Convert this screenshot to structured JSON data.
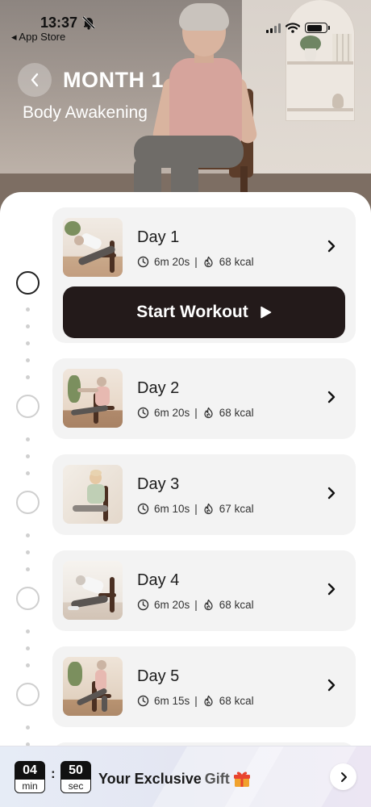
{
  "status_bar": {
    "time": "13:37",
    "back_app": "◂ App Store"
  },
  "header": {
    "title": "MONTH 1",
    "subtitle": "Body Awakening"
  },
  "start_button": {
    "label": "Start Workout"
  },
  "days": [
    {
      "title": "Day 1",
      "duration": "6m 20s",
      "separator": "|",
      "calories": "68 kcal"
    },
    {
      "title": "Day 2",
      "duration": "6m 20s",
      "separator": "|",
      "calories": "68 kcal"
    },
    {
      "title": "Day 3",
      "duration": "6m 10s",
      "separator": "|",
      "calories": "67 kcal"
    },
    {
      "title": "Day 4",
      "duration": "6m 20s",
      "separator": "|",
      "calories": "68 kcal"
    },
    {
      "title": "Day 5",
      "duration": "6m 15s",
      "separator": "|",
      "calories": "68 kcal"
    }
  ],
  "promo": {
    "minutes": "04",
    "minutes_unit": "min",
    "colon": ":",
    "seconds": "50",
    "seconds_unit": "sec",
    "text_main": "Your Exclusive",
    "text_soft": "Gift"
  },
  "icons": {
    "back": "chevron-left-icon",
    "chevron": "chevron-right-icon",
    "clock": "clock-icon",
    "flame": "flame-icon",
    "play": "play-icon",
    "gift": "gift-icon"
  },
  "colors": {
    "start_button_bg": "#231a1a",
    "card_bg": "#f3f3f3",
    "title_text": "#ffffff"
  }
}
